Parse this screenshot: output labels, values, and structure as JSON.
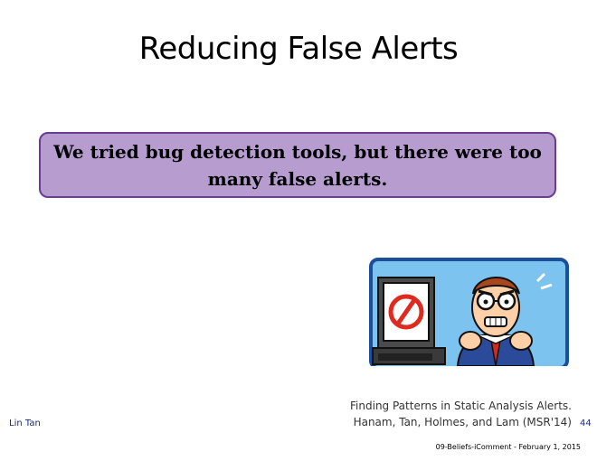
{
  "slide": {
    "title": "Reducing False Alerts",
    "callout_text": "We tried bug detection tools, but there were too many false alerts.",
    "citation_line1": "Finding Patterns in Static Analysis Alerts.",
    "citation_line2": "Hanam, Tan, Holmes, and Lam (MSR'14)",
    "author": "Lin Tan",
    "page_number": "44",
    "footer": "09-Beliefs-iComment - February 1, 2015"
  },
  "illustration": {
    "icon": "frustrated-man-at-computer-icon",
    "colors": {
      "frame": "#1b4e9b",
      "sky": "#7cc3ef",
      "screen": "#ffffff",
      "no_sign": "#e02a1f",
      "suit": "#2b4b9a",
      "tie": "#d42a1a",
      "skin": "#ffd0a8",
      "hair": "#a9461b"
    }
  },
  "theme": {
    "callout_fill": "#b69ccf",
    "callout_border": "#6a3c93",
    "accent_text": "#1a2a8c"
  }
}
